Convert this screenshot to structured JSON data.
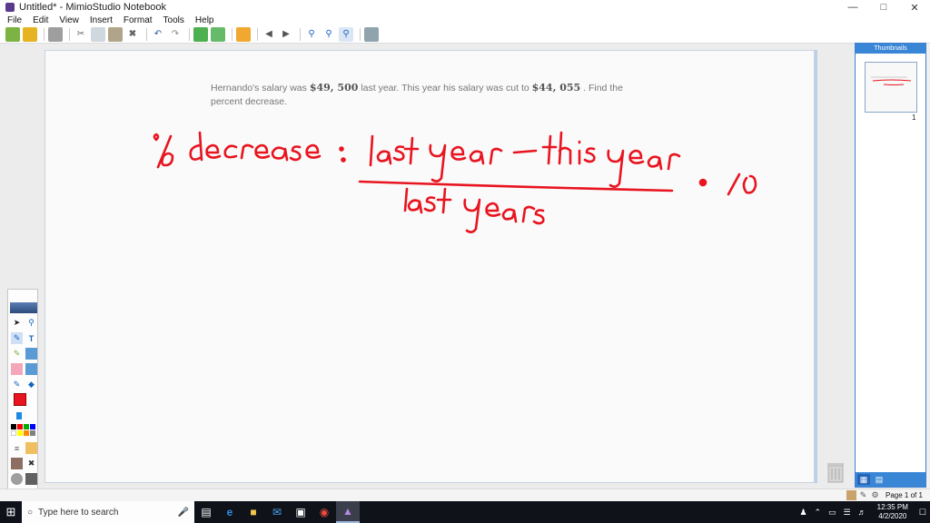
{
  "window": {
    "title": "Untitled* - MimioStudio Notebook"
  },
  "menu": [
    "File",
    "Edit",
    "View",
    "Insert",
    "Format",
    "Tools",
    "Help"
  ],
  "problem": {
    "part1": "Hernando's salary was ",
    "amount1": "$49, 500",
    "part2": " last year. This year his salary was cut to ",
    "amount2": "$44, 055",
    "part3": " . Find the percent decrease."
  },
  "ink_color": "#e8141f",
  "ink_text": {
    "label": "% decrease:",
    "numerator": "last year - this year",
    "denominator": "last years",
    "multiplier": "· 10"
  },
  "right_panel": {
    "header": "Thumbnails",
    "thumb_number": "1",
    "page_label": "Page 1 of 1"
  },
  "taskbar": {
    "search_placeholder": "Type here to search",
    "time": "12:35 PM",
    "date": "4/2/2020"
  },
  "palette_colors": [
    "#000000",
    "#ff0000",
    "#00b000",
    "#0000ff",
    "#ffffff",
    "#ffff00",
    "#ff8800",
    "#808080"
  ]
}
